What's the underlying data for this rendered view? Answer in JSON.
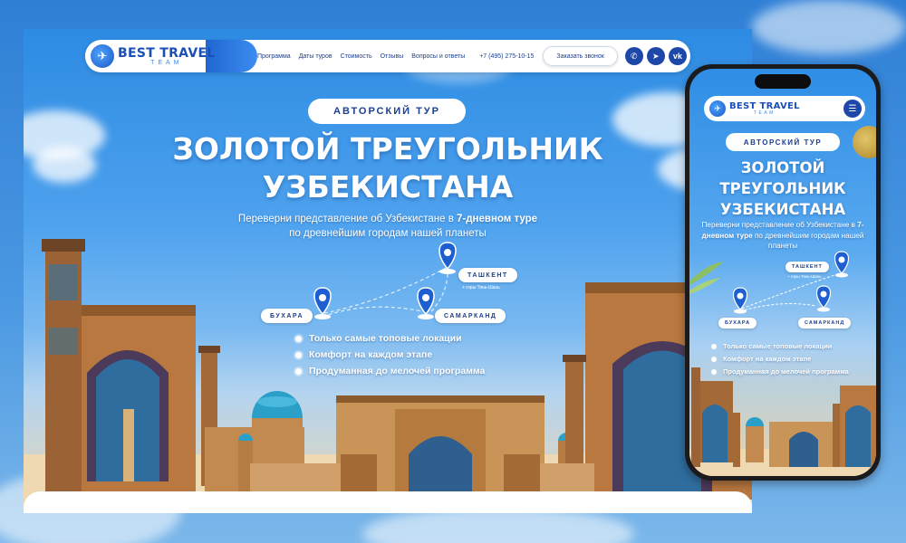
{
  "brand": {
    "name": "BEST TRAVEL",
    "sub": "TEAM"
  },
  "nav": {
    "links": [
      "Программа",
      "Даты туров",
      "Стоимость",
      "Отзывы",
      "Вопросы и ответы"
    ],
    "phone": "+7 (495) 275-10-15",
    "callback": "Заказать звонок",
    "social": [
      {
        "icon": "whatsapp-icon",
        "glyph": "✆"
      },
      {
        "icon": "telegram-icon",
        "glyph": "➤"
      },
      {
        "icon": "vk-icon",
        "glyph": "vk"
      }
    ]
  },
  "hero": {
    "badge": "АВТОРСКИЙ ТУР",
    "title_line1": "ЗОЛОТОЙ ТРЕУГОЛЬНИК",
    "title_line2": "УЗБЕКИСТАНА",
    "subtitle_pre": "Переверни представление об Узбекистане в ",
    "subtitle_bold": "7-дневном туре",
    "subtitle_post": "по древнейшим городам нашей планеты"
  },
  "route": {
    "cities": [
      "БУХАРА",
      "САМАРКАНД",
      "ТАШКЕНТ"
    ],
    "tashkent_note": "+ горы Тянь-Шань"
  },
  "bullets": [
    "Только самые топовые локации",
    "Комфорт на каждом этапе",
    "Продуманная до мелочей программа"
  ],
  "mobile": {
    "subtitle_pre": "Переверни представление об Узбекистане в ",
    "subtitle_bold": "7-дневном туре",
    "subtitle_post": " по древнейшим городам нашей планеты",
    "menu_icon": "burger-menu-icon"
  },
  "colors": {
    "brand_blue": "#1d47a8",
    "nav_text": "#1c3f8f",
    "sky": "#2d8be3"
  }
}
